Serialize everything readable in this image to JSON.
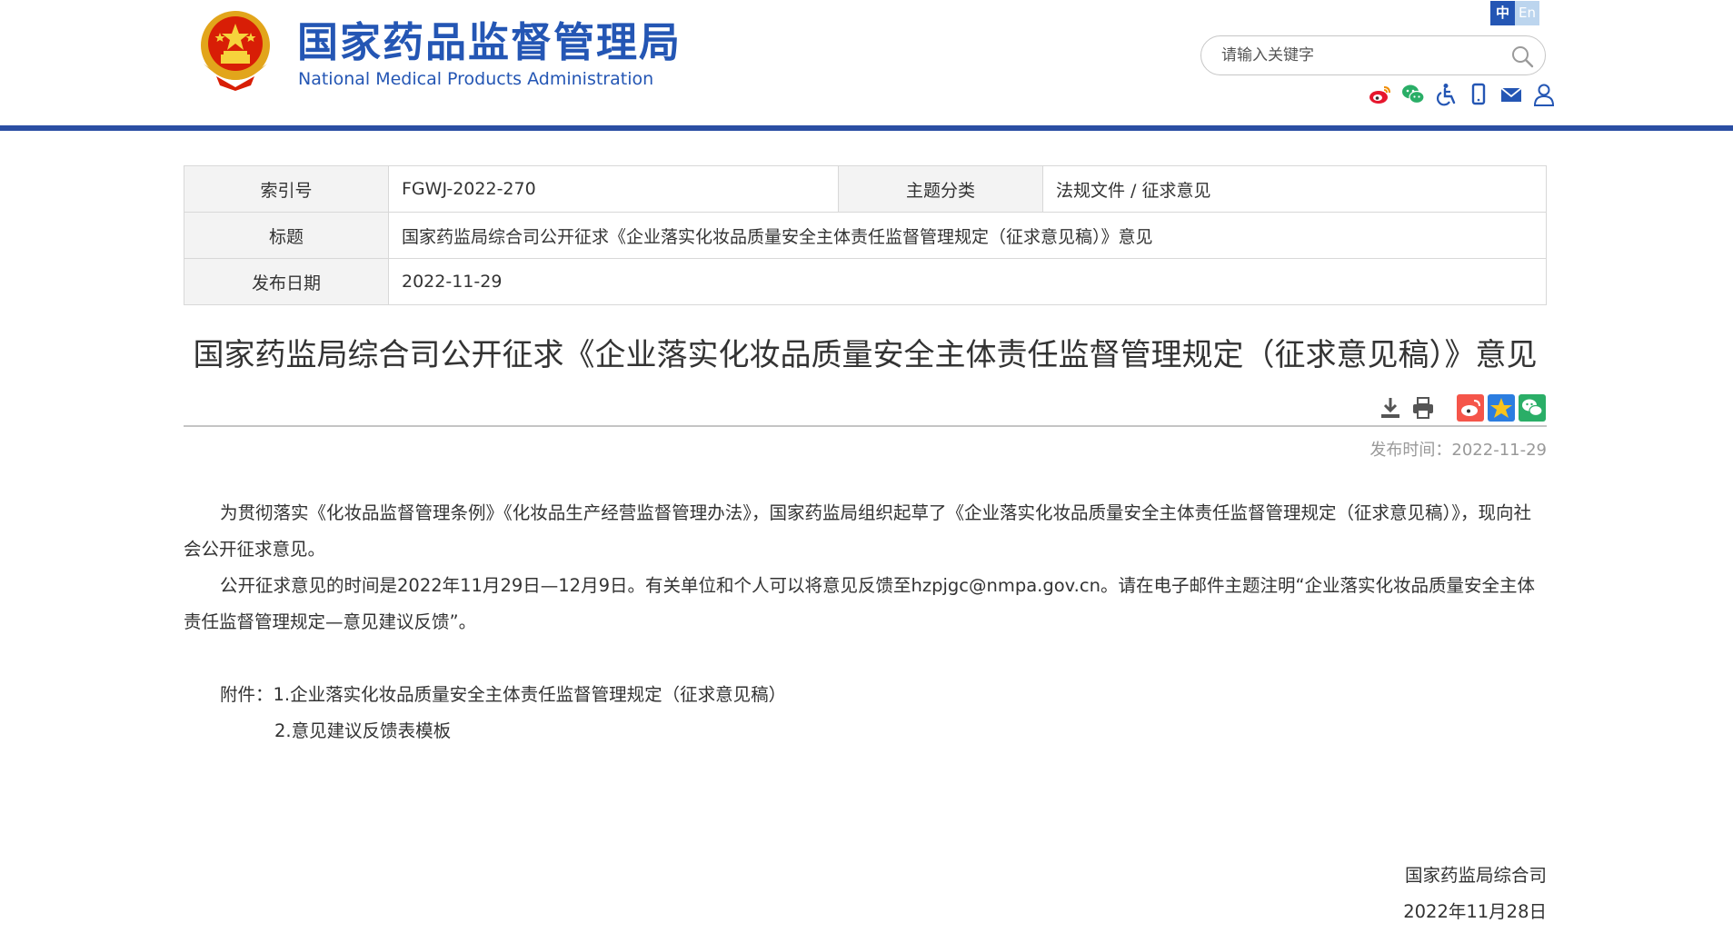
{
  "header": {
    "site_name_cn": "国家药品监督管理局",
    "site_name_en": "National Medical Products Administration",
    "lang_cn": "中",
    "lang_en": "En",
    "search_placeholder": "请输入关键字",
    "tool_icons": [
      "weibo-icon",
      "wechat-icon",
      "accessibility-icon",
      "mobile-icon",
      "mail-icon",
      "user-icon"
    ],
    "accent_color": "#2456b4"
  },
  "meta": {
    "index_label": "索引号",
    "index_value": "FGWJ-2022-270",
    "category_label": "主题分类",
    "category_value": "法规文件 / 征求意见",
    "title_label": "标题",
    "title_value": "国家药监局综合司公开征求《企业落实化妆品质量安全主体责任监督管理规定（征求意见稿）》意见",
    "date_label": "发布日期",
    "date_value": "2022-11-29"
  },
  "article": {
    "title": "国家药监局综合司公开征求《企业落实化妆品质量安全主体责任监督管理规定（征求意见稿）》意见",
    "pubtime": "发布时间：2022-11-29",
    "paragraphs": [
      "为贯彻落实《化妆品监督管理条例》《化妆品生产经营监督管理办法》，国家药监局组织起草了《企业落实化妆品质量安全主体责任监督管理规定（征求意见稿）》，现向社会公开征求意见。",
      "公开征求意见的时间是2022年11月29日—12月9日。有关单位和个人可以将意见反馈至hzpjgc@nmpa.gov.cn。请在电子邮件主题注明“企业落实化妆品质量安全主体责任监督管理规定—意见建议反馈”。"
    ],
    "attachment_label": "附件：",
    "attachments": [
      "1.企业落实化妆品质量安全主体责任监督管理规定（征求意见稿）",
      "2.意见建议反馈表模板"
    ],
    "signature_org": "国家药监局综合司",
    "signature_date": "2022年11月28日",
    "action_icons": [
      "download-icon",
      "print-icon"
    ],
    "share_icons": [
      "share-weibo-icon",
      "share-qzone-icon",
      "share-wechat-icon"
    ]
  }
}
